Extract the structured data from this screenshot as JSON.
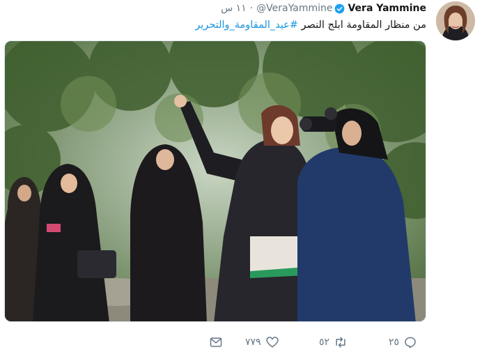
{
  "tweet": {
    "author_name": "Vera Yammine",
    "handle": "@VeraYammine",
    "separator": "·",
    "time": "١١ س",
    "text": "من منظار المقاومة ابلج النصر ",
    "hashtag": "#عيد_المقاومة_والتحرير",
    "avatar_icon": "profile-photo",
    "verified_icon": "verified-badge-icon",
    "media_description_icon": "photo"
  },
  "actions": {
    "reply_count": "٢٥",
    "retweet_count": "٥٢",
    "like_count": "٧٧٩",
    "reply_icon": "reply-icon",
    "retweet_icon": "retweet-icon",
    "like_icon": "heart-icon",
    "message_icon": "envelope-icon"
  },
  "colors": {
    "link": "#1b95e0",
    "muted": "#657786",
    "verified": "#1da1f2"
  }
}
